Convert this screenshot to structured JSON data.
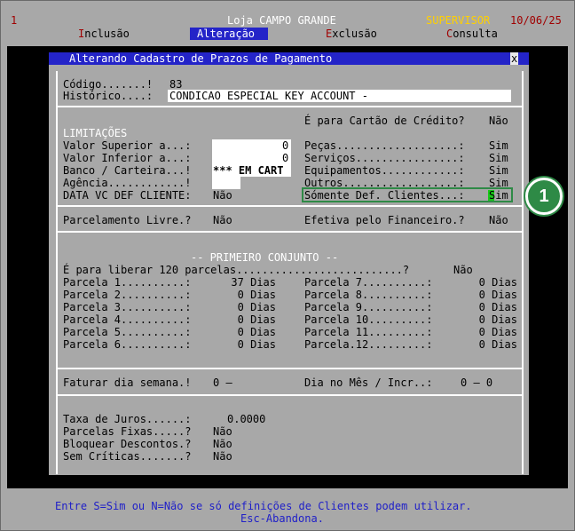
{
  "header": {
    "num": "1",
    "store": "Loja CAMPO GRANDE",
    "role": "SUPERVISOR",
    "date": "10/06/25"
  },
  "menu": [
    {
      "hot": "I",
      "rest": "nclusão"
    },
    {
      "hot": "",
      "rest": "Alteração"
    },
    {
      "hot": "E",
      "rest": "xclusão"
    },
    {
      "hot": "C",
      "rest": "onsulta"
    }
  ],
  "window": {
    "title": "Alterando Cadastro de Prazos de Pagamento",
    "close": "x",
    "codigo_label": "Código.......!",
    "codigo_value": "83",
    "historico_label": "Histórico....:",
    "historico_value": "CONDICAO ESPECIAL KEY ACCOUNT -",
    "cartao_label": "É para Cartão de Crédito?",
    "cartao_value": "Não",
    "limitacoes": "LIMITAÇÕES",
    "valor_sup_label": "Valor Superior a...:",
    "valor_sup_value": "0",
    "valor_inf_label": "Valor Inferior a...:",
    "valor_inf_value": "0",
    "banco_label": "Banco / Carteira...!",
    "banco_value": "*** EM CART",
    "agencia_label": "Agência............!",
    "datavc_label": "DATA VC DEF CLIENTE:",
    "datavc_value": "Não",
    "right_opts": [
      {
        "label": "Peças...................:",
        "value": "Sim"
      },
      {
        "label": "Serviços................:",
        "value": "Sim"
      },
      {
        "label": "Equipamentos............:",
        "value": "Sim"
      },
      {
        "label": "Outros..................:",
        "value": "Sim"
      },
      {
        "label": "Sómente Def. Clientes...:",
        "value": "Sim"
      }
    ],
    "parcelamento_label": "Parcelamento Livre.?",
    "parcelamento_value": "Não",
    "efetiva_label": "Efetiva pelo Financeiro.?",
    "efetiva_value": "Não",
    "conjunto_title": "-- PRIMEIRO CONJUNTO --",
    "liberar_label": "É para liberar 120 parcelas..........................?",
    "liberar_value": "Não",
    "parcelas_left": [
      {
        "label": "Parcela 1..........:",
        "value": "37 Dias"
      },
      {
        "label": "Parcela 2..........:",
        "value": "0 Dias"
      },
      {
        "label": "Parcela 3..........:",
        "value": "0 Dias"
      },
      {
        "label": "Parcela 4..........:",
        "value": "0 Dias"
      },
      {
        "label": "Parcela 5..........:",
        "value": "0 Dias"
      },
      {
        "label": "Parcela 6..........:",
        "value": "0 Dias"
      }
    ],
    "parcelas_right": [
      {
        "label": "Parcela 7..........:",
        "value": "0 Dias"
      },
      {
        "label": "Parcela 8..........:",
        "value": "0 Dias"
      },
      {
        "label": "Parcela 9..........:",
        "value": "0 Dias"
      },
      {
        "label": "Parcela 10.........:",
        "value": "0 Dias"
      },
      {
        "label": "Parcela 11.........:",
        "value": "0 Dias"
      },
      {
        "label": "Parcela.12.........:",
        "value": "0 Dias"
      }
    ],
    "faturar_label": "Faturar dia semana.!",
    "faturar_value": "0 –",
    "diames_label": "Dia no Mês / Incr..:",
    "diames_value": "0 – 0",
    "juros_label": "Taxa de Juros......:",
    "juros_value": "0.0000",
    "fixas_label": "Parcelas Fixas.....?",
    "fixas_value": "Não",
    "bloquear_label": "Bloquear Descontos.?",
    "bloquear_value": "Não",
    "criticas_label": "Sem Críticas.......?",
    "criticas_value": "Não"
  },
  "status": {
    "line1": "Entre S=Sim ou N=Não se só definições de Clientes podem utilizar.",
    "line2": "Esc-Abandona."
  },
  "callout": "1"
}
